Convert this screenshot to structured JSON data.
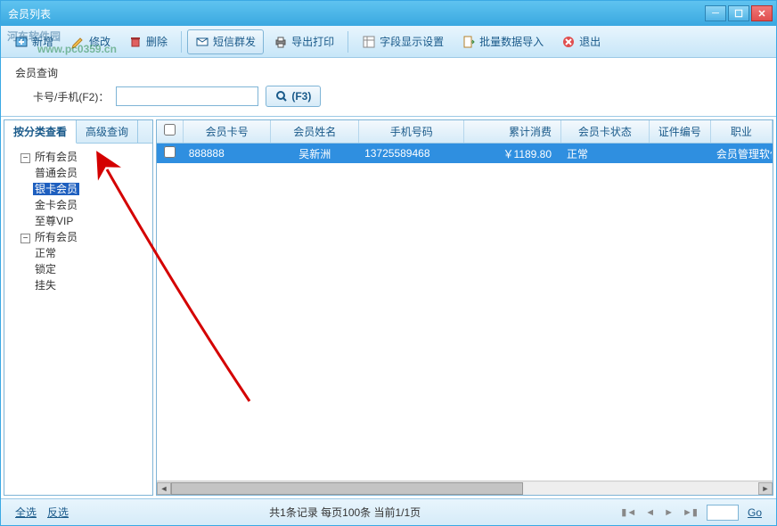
{
  "window": {
    "title": "会员列表"
  },
  "watermark": {
    "main": "河东软件园",
    "sub": "www.pc0359.cn"
  },
  "toolbar": {
    "new": "新增",
    "edit": "修改",
    "delete": "删除",
    "sms": "短信群发",
    "export": "导出打印",
    "fields": "字段显示设置",
    "import": "批量数据导入",
    "exit": "退出"
  },
  "search": {
    "group_title": "会员查询",
    "label": "卡号/手机(F2)：",
    "value": "",
    "button": "(F3)"
  },
  "left": {
    "tab1": "按分类查看",
    "tab2": "高级查询",
    "tree": {
      "root1": "所有会员",
      "root1_children": [
        "普通会员",
        "银卡会员",
        "金卡会员",
        "至尊VIP"
      ],
      "root2": "所有会员",
      "root2_children": [
        "正常",
        "锁定",
        "挂失"
      ],
      "selected": "银卡会员"
    }
  },
  "grid": {
    "headers": [
      "",
      "会员卡号",
      "会员姓名",
      "手机号码",
      "累计消费",
      "会员卡状态",
      "证件编号",
      "职业"
    ],
    "rows": [
      {
        "checked": false,
        "card": "888888",
        "name": "吴新洲",
        "phone": "13725589468",
        "spend": "￥1189.80",
        "status": "正常",
        "idno": "",
        "job": "会员管理软件"
      }
    ]
  },
  "footer": {
    "select_all": "全选",
    "invert": "反选",
    "info": "共1条记录  每页100条  当前1/1页",
    "page_value": "",
    "go": "Go"
  }
}
